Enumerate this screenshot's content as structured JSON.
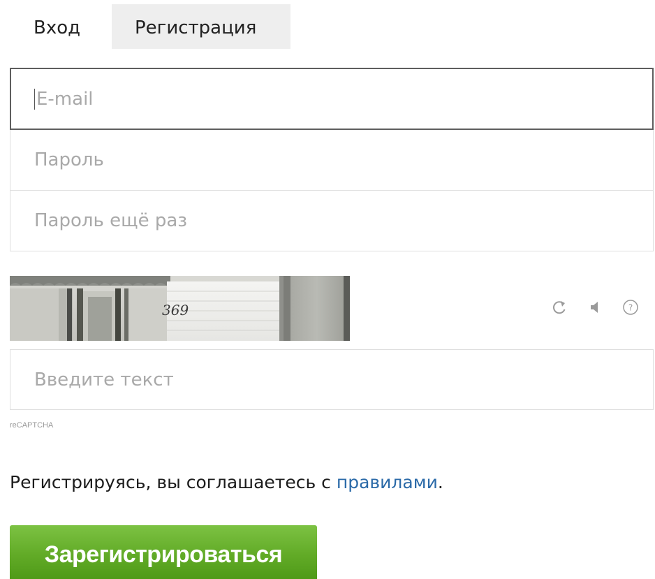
{
  "tabs": {
    "login": "Вход",
    "register": "Регистрация"
  },
  "form": {
    "email_placeholder": "E-mail",
    "password_placeholder": "Пароль",
    "password_repeat_placeholder": "Пароль ещё раз",
    "captcha_input_placeholder": "Введите текст",
    "captcha_number": "369",
    "recaptcha_label": "reCAPTCHA"
  },
  "captcha_icons": [
    "refresh-icon",
    "audio-icon",
    "help-icon"
  ],
  "agreement": {
    "prefix": "Регистрируясь, вы соглашаетесь с",
    "link": "правилами",
    "suffix": "."
  },
  "submit_label": "Зарегистрироваться",
  "colors": {
    "active_tab_bg": "#eeeeee",
    "link": "#2b6aa8",
    "button_green": "#62ab27"
  }
}
